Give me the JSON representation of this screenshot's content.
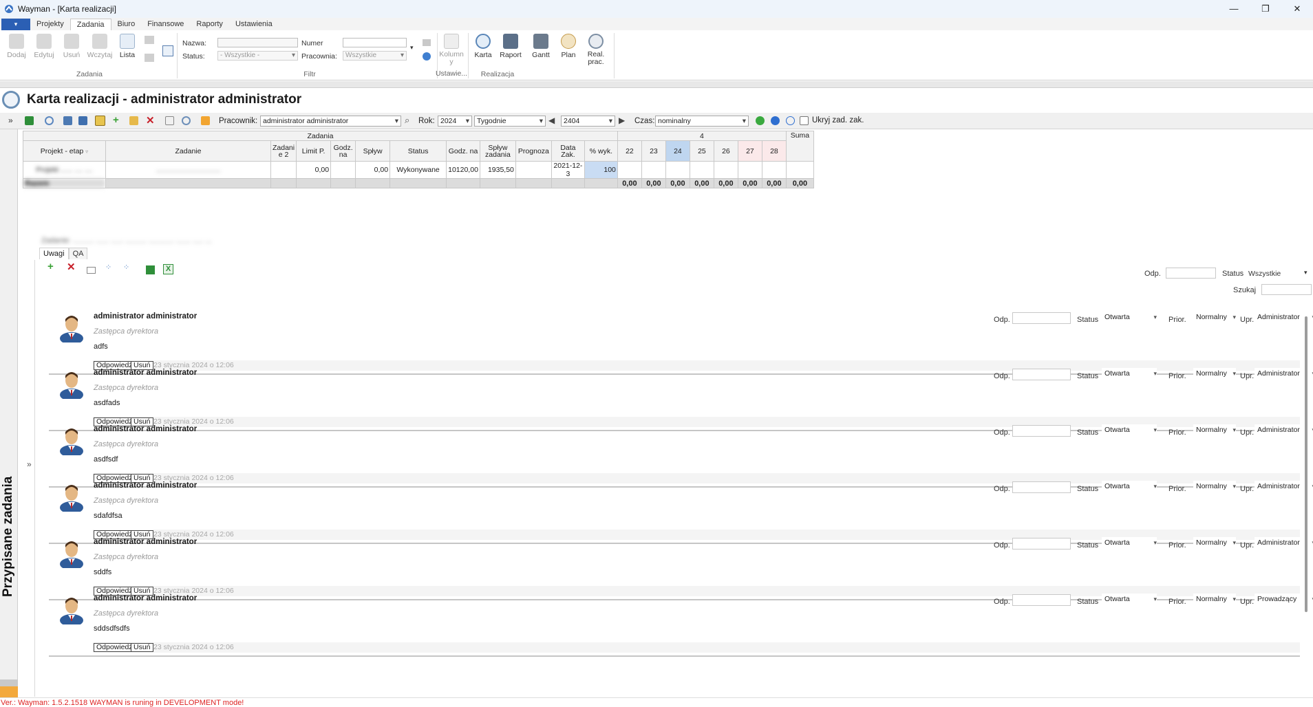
{
  "window": {
    "title": "Wayman - [Karta realizacji]",
    "controls": [
      "—",
      "❐",
      "✕"
    ]
  },
  "menu": {
    "app_button": "▾",
    "tabs": [
      "Projekty",
      "Zadania",
      "Biuro",
      "Finansowe",
      "Raporty",
      "Ustawienia"
    ],
    "active_tab": "Zadania"
  },
  "ribbon": {
    "zadania_buttons": [
      "Dodaj",
      "Edytuj",
      "Usuń",
      "Wczytaj",
      "Lista"
    ],
    "zadania_group": "Zadania",
    "filter": {
      "nazwa_label": "Nazwa:",
      "status_label": "Status:",
      "status_value": "- Wszystkie -",
      "numer_label": "Numer",
      "pracownia_label": "Pracownia:",
      "pracownia_value": "Wszystkie"
    },
    "filter_group": "Filtr",
    "kolumny_label": "Kolumn y",
    "ustawienia_group": "Ustawie...",
    "realizacja_buttons": [
      "Karta",
      "Raport",
      "Gantt",
      "Plan",
      "Real. prac."
    ],
    "realizacja_group": "Realizacja"
  },
  "page": {
    "title": "Karta realizacji - administrator administrator"
  },
  "toolbar": {
    "pracownik_label": "Pracownik:",
    "pracownik_value": "administrator administrator",
    "rok_label": "Rok:",
    "rok_value": "2024",
    "okres_value": "Tygodnie",
    "tydzien_value": "2404",
    "czas_label": "Czas:",
    "czas_value": "nominalny",
    "ukryj_label": "Ukryj zad. zak."
  },
  "sidebar": {
    "label": "Przypisane zadania"
  },
  "grid": {
    "group_header": "Zadania",
    "week_header": "4",
    "suma_header": "Suma",
    "columns": [
      "Projekt - etap",
      "Zadanie",
      "Zadani e 2",
      "Limit P.",
      "Godz. na",
      "Spływ",
      "Status",
      "Godz. na",
      "Spływ zadania",
      "Prognoza",
      "Data Zak.",
      "% wyk."
    ],
    "days": [
      "22",
      "23",
      "24",
      "25",
      "26",
      "27",
      "28"
    ],
    "row": {
      "limit": "0,00",
      "splyw": "0,00",
      "status": "Wykonywane",
      "godz": "10120,00",
      "splyw_zad": "1935,50",
      "data": "2021-12-3",
      "wyk": "100"
    },
    "totals": [
      "0,00",
      "0,00",
      "0,00",
      "0,00",
      "0,00",
      "0,00",
      "0,00",
      "0,00"
    ],
    "blur_project": "Projekt ......  ....  ....",
    "blur_task": "................................",
    "blur_total": "Razem"
  },
  "detail": {
    "blur_header": "Zadanie: .......... ...... ...... .......... ............ ....... ..... ...",
    "tabs": [
      "Uwagi",
      "QA"
    ],
    "odp_label": "Odp.",
    "status_label": "Status",
    "status_value": "Wszystkie",
    "szukaj_label": "Szukaj"
  },
  "comments": [
    {
      "author": "administrator  administrator",
      "role": "Zastępca dyrektora",
      "text": "adfs",
      "reply": "Odpowiedź",
      "delete": "Usuń",
      "date": "23 stycznia 2024 o 12:06",
      "odp_label": "Odp.",
      "status_label": "Status",
      "status": "Otwarta",
      "prior_label": "Prior.",
      "prior": "Normalny",
      "upr_label": "Upr.",
      "upr": "Administrator"
    },
    {
      "author": "administrator  administrator",
      "role": "Zastępca dyrektora",
      "text": "asdfads",
      "reply": "Odpowiedź",
      "delete": "Usuń",
      "date": "23 stycznia 2024 o 12:06",
      "odp_label": "Odp.",
      "status_label": "Status",
      "status": "Otwarta",
      "prior_label": "Prior.",
      "prior": "Normalny",
      "upr_label": "Upr.",
      "upr": "Administrator"
    },
    {
      "author": "administrator  administrator",
      "role": "Zastępca dyrektora",
      "text": "asdfsdf",
      "reply": "Odpowiedź",
      "delete": "Usuń",
      "date": "23 stycznia 2024 o 12:06",
      "odp_label": "Odp.",
      "status_label": "Status",
      "status": "Otwarta",
      "prior_label": "Prior.",
      "prior": "Normalny",
      "upr_label": "Upr.",
      "upr": "Administrator"
    },
    {
      "author": "administrator  administrator",
      "role": "Zastępca dyrektora",
      "text": "sdafdfsa",
      "reply": "Odpowiedź",
      "delete": "Usuń",
      "date": "23 stycznia 2024 o 12:06",
      "odp_label": "Odp.",
      "status_label": "Status",
      "status": "Otwarta",
      "prior_label": "Prior.",
      "prior": "Normalny",
      "upr_label": "Upr.",
      "upr": "Administrator"
    },
    {
      "author": "administrator  administrator",
      "role": "Zastępca dyrektora",
      "text": "sddfs",
      "reply": "Odpowiedź",
      "delete": "Usuń",
      "date": "23 stycznia 2024 o 12:06",
      "odp_label": "Odp.",
      "status_label": "Status",
      "status": "Otwarta",
      "prior_label": "Prior.",
      "prior": "Normalny",
      "upr_label": "Upr.",
      "upr": "Administrator"
    },
    {
      "author": "administrator  administrator",
      "role": "Zastępca dyrektora",
      "text": "sddsdfsdfs",
      "reply": "Odpowiedź",
      "delete": "Usuń",
      "date": "23 stycznia 2024 o 12:06",
      "odp_label": "Odp.",
      "status_label": "Status",
      "status": "Otwarta",
      "prior_label": "Prior.",
      "prior": "Normalny",
      "upr_label": "Upr.",
      "upr": "Prowadzący"
    }
  ],
  "status_bar": {
    "text": "Ver.: Wayman: 1.5.2.1518 WAYMAN is runing in DEVELOPMENT mode!"
  },
  "colors": {
    "accent": "#2b5fb4",
    "selected_day": "#bfd6f0",
    "weekend": "#fbe9ea",
    "status_text": "#dd2222",
    "orange": "#f3a93c"
  }
}
